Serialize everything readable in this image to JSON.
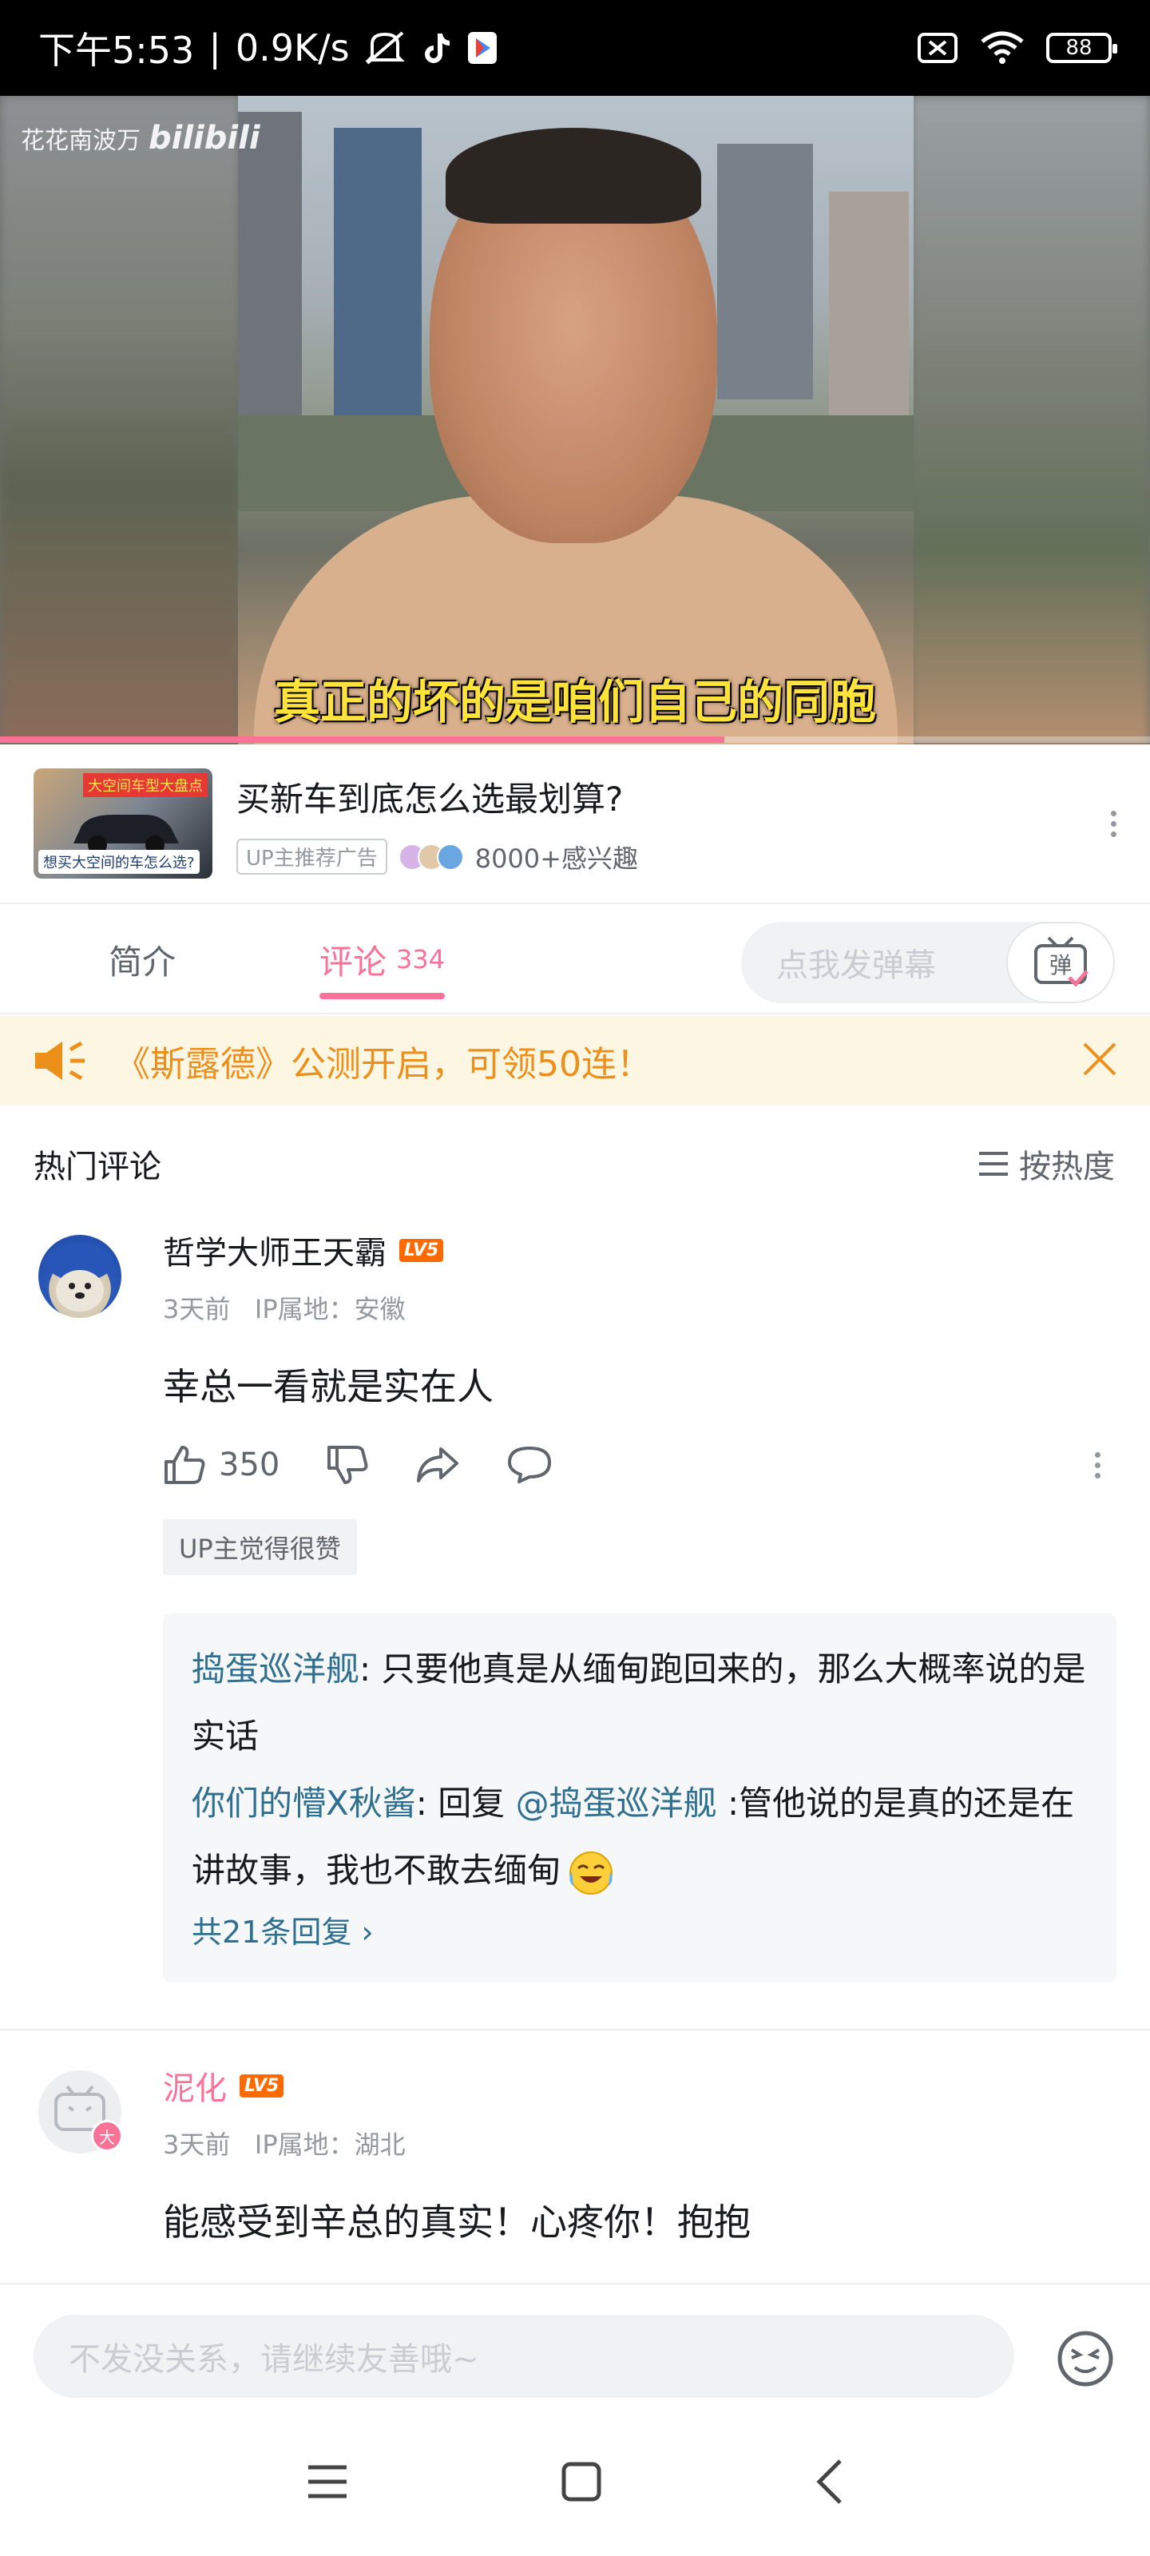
{
  "status_bar": {
    "time": "下午5:53",
    "separator": "|",
    "speed": "0.9K/s",
    "battery": "88",
    "icons": [
      "mute-icon",
      "tiktok-icon",
      "play-store-icon",
      "sim-off-icon",
      "wifi-icon",
      "battery-icon"
    ]
  },
  "video": {
    "watermark_author": "花花南波万",
    "watermark_logo": "bilibili",
    "subtitle": "真正的坏的是咱们自己的同胞",
    "progress": 0.63
  },
  "ad": {
    "title": "买新车到底怎么选最划算?",
    "tag": "UP主推荐广告",
    "interest": "8000+感兴趣",
    "thumb_label_top": "大空间车型大盘点",
    "thumb_label_bottom": "想买大空间的车怎么选?"
  },
  "tabs": {
    "intro": "简介",
    "comments": "评论",
    "comments_count": "334",
    "danmu_placeholder": "点我发弹幕",
    "danmu_button": "弹"
  },
  "notice": {
    "text": "《斯露德》公测开启，可领50连！"
  },
  "comments_header": {
    "title": "热门评论",
    "sort": "按热度"
  },
  "comments": [
    {
      "user": "哲学大师王天霸",
      "level": "LV5",
      "time": "3天前",
      "ip": "IP属地：安徽",
      "text": "幸总一看就是实在人",
      "likes": "350",
      "up_badge": "UP主觉得很赞",
      "replies": [
        {
          "user": "捣蛋巡洋舰",
          "text": ": 只要他真是从缅甸跑回来的，那么大概率说的是实话"
        },
        {
          "user": "你们的懵X秋酱",
          "text_pre": ": 回复 ",
          "at": "@捣蛋巡洋舰",
          "text": " :管他说的是真的还是在讲故事，我也不敢去缅甸"
        }
      ],
      "more_replies": "共21条回复"
    },
    {
      "user": "泥化",
      "level": "LV5",
      "time": "3天前",
      "ip": "IP属地：湖北",
      "text": "能感受到辛总的真实！心疼你！抱抱"
    }
  ],
  "input": {
    "placeholder": "不发没关系，请继续友善哦~"
  },
  "colors": {
    "accent": "#fb7299",
    "notice_text": "#ed8f1b",
    "notice_bg": "#fdf6e3",
    "link": "#2f6f8f",
    "level_badge": "#ff6a00"
  }
}
